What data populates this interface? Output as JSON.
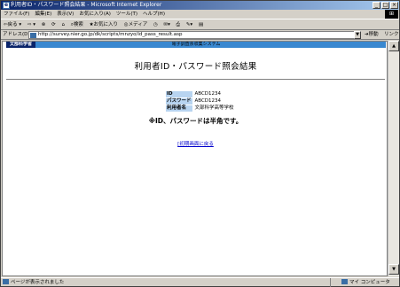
{
  "window": {
    "title": "利用者ID・パスワード照会結果 - Microsoft Internet Explorer",
    "minimize": "_",
    "maximize": "□",
    "close": "×"
  },
  "menu": [
    "ファイル(F)",
    "編集(E)",
    "表示(V)",
    "お気に入り(A)",
    "ツール(T)",
    "ヘルプ(H)"
  ],
  "toolbar": {
    "back_label": "戻る",
    "search_label": "検索",
    "favorites_label": "お気に入り",
    "media_label": "メディア"
  },
  "address": {
    "label": "アドレス(D)",
    "url": "http://survey.nier.go.jp/dk/scripts/mnzyo/id_pass_result.asp",
    "go_label": "移動",
    "links_label": "リンク"
  },
  "page": {
    "logo": "文部科学省",
    "system_name": "電子調査票収集システム",
    "heading": "利用者ID・パスワード照会結果",
    "rows": [
      {
        "key": "ID",
        "value": "ABCD1234"
      },
      {
        "key": "パスワード",
        "value": "ABCD1234"
      },
      {
        "key": "利用者名",
        "value": "文部科学高等学校"
      }
    ],
    "note": "※ID、パスワードは半角です。",
    "back_link": "[初期画面に戻る"
  },
  "status": {
    "message": "ページが表示されました",
    "zone": "マイ コンピュータ"
  },
  "colors": {
    "titlebar": "#0a246a",
    "header_bar": "#3a88d0",
    "key_cell": "#b8d4f0",
    "link": "#0000cc"
  }
}
